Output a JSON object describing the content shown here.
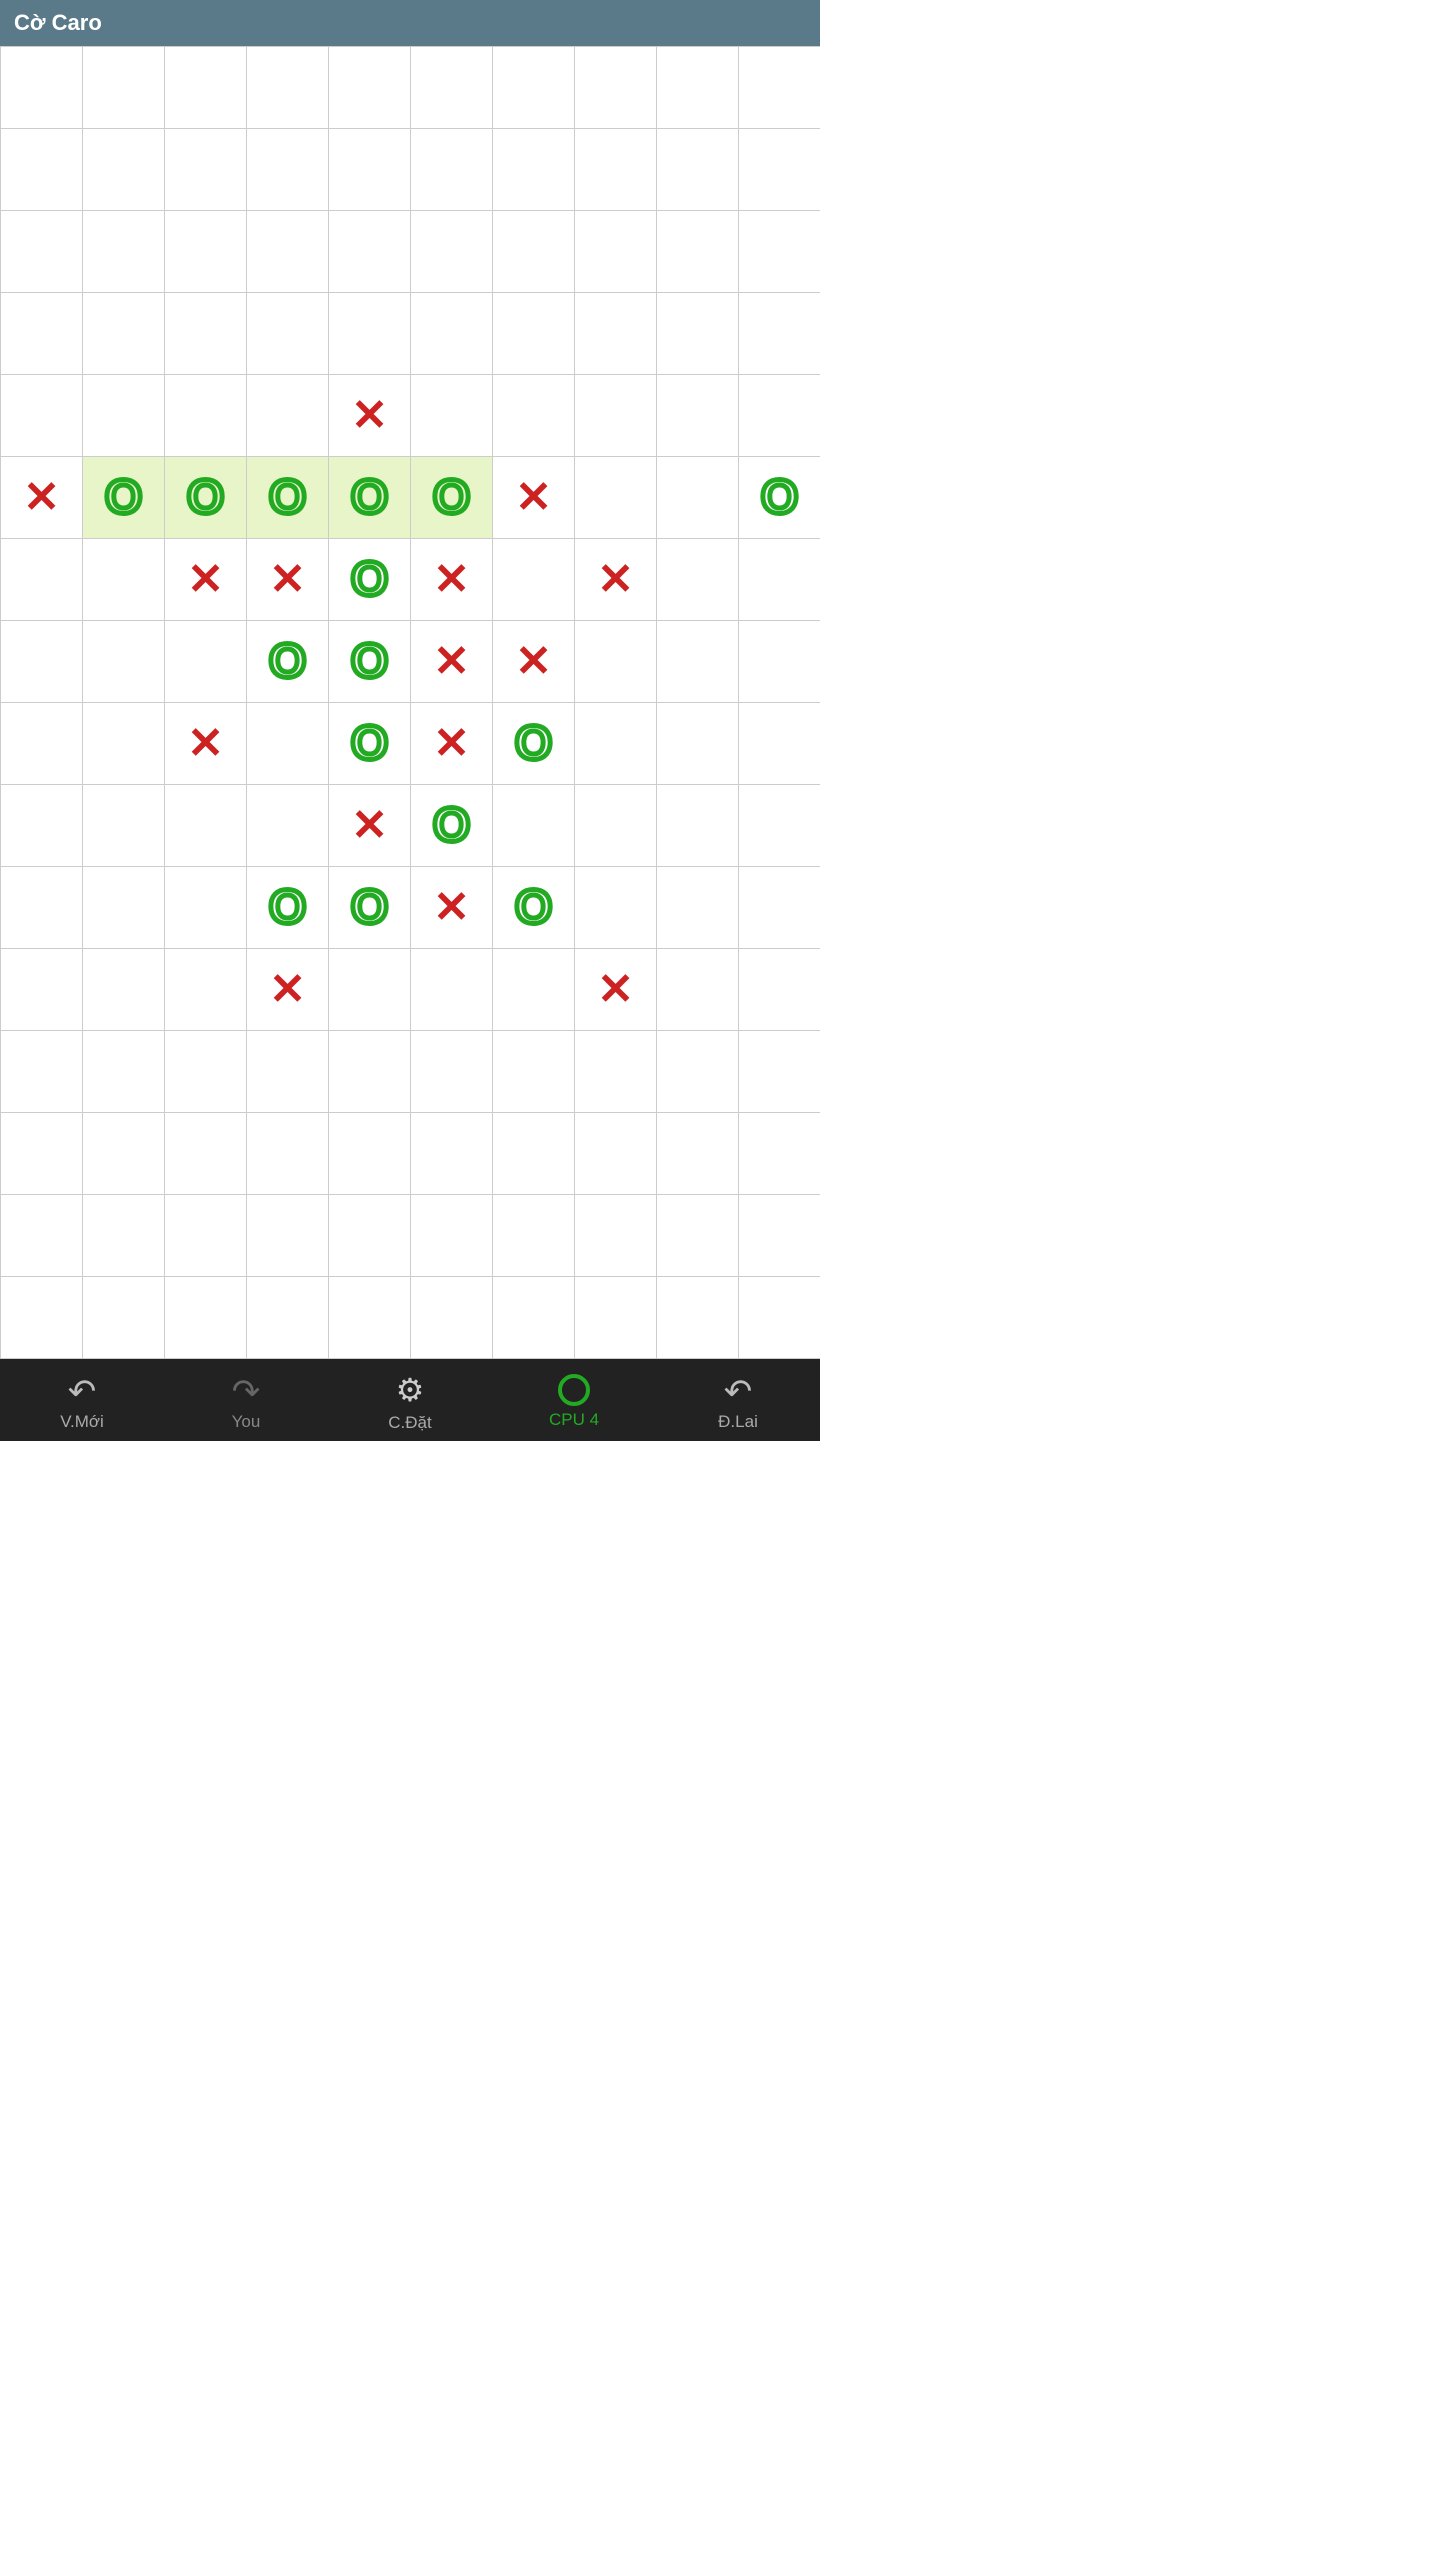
{
  "app": {
    "title": "Cờ Caro"
  },
  "toolbar": {
    "new_game_label": "V.Mới",
    "you_label": "You",
    "settings_label": "C.Đặt",
    "cpu_label": "CPU 4",
    "undo_label": "Đ.Lai"
  },
  "board": {
    "cols": 10,
    "rows": 16,
    "highlight_row": 5,
    "highlight_cols": [
      1,
      2,
      3,
      4,
      5
    ],
    "cells": [
      {
        "row": 4,
        "col": 4,
        "piece": "X"
      },
      {
        "row": 5,
        "col": 0,
        "piece": "X"
      },
      {
        "row": 5,
        "col": 1,
        "piece": "O",
        "highlight": true
      },
      {
        "row": 5,
        "col": 2,
        "piece": "O",
        "highlight": true
      },
      {
        "row": 5,
        "col": 3,
        "piece": "O",
        "highlight": true
      },
      {
        "row": 5,
        "col": 4,
        "piece": "O",
        "highlight": true
      },
      {
        "row": 5,
        "col": 5,
        "piece": "O",
        "highlight": true
      },
      {
        "row": 5,
        "col": 6,
        "piece": "X"
      },
      {
        "row": 5,
        "col": 9,
        "piece": "O"
      },
      {
        "row": 6,
        "col": 2,
        "piece": "X"
      },
      {
        "row": 6,
        "col": 3,
        "piece": "X"
      },
      {
        "row": 6,
        "col": 4,
        "piece": "O"
      },
      {
        "row": 6,
        "col": 5,
        "piece": "X"
      },
      {
        "row": 6,
        "col": 7,
        "piece": "X"
      },
      {
        "row": 7,
        "col": 3,
        "piece": "O"
      },
      {
        "row": 7,
        "col": 4,
        "piece": "O"
      },
      {
        "row": 7,
        "col": 5,
        "piece": "X"
      },
      {
        "row": 7,
        "col": 6,
        "piece": "X"
      },
      {
        "row": 8,
        "col": 2,
        "piece": "X"
      },
      {
        "row": 8,
        "col": 4,
        "piece": "O"
      },
      {
        "row": 8,
        "col": 5,
        "piece": "X"
      },
      {
        "row": 8,
        "col": 6,
        "piece": "O"
      },
      {
        "row": 9,
        "col": 4,
        "piece": "X"
      },
      {
        "row": 9,
        "col": 5,
        "piece": "O"
      },
      {
        "row": 10,
        "col": 3,
        "piece": "O"
      },
      {
        "row": 10,
        "col": 4,
        "piece": "O"
      },
      {
        "row": 10,
        "col": 5,
        "piece": "X"
      },
      {
        "row": 10,
        "col": 6,
        "piece": "O"
      },
      {
        "row": 11,
        "col": 3,
        "piece": "X"
      },
      {
        "row": 11,
        "col": 7,
        "piece": "X"
      }
    ]
  }
}
